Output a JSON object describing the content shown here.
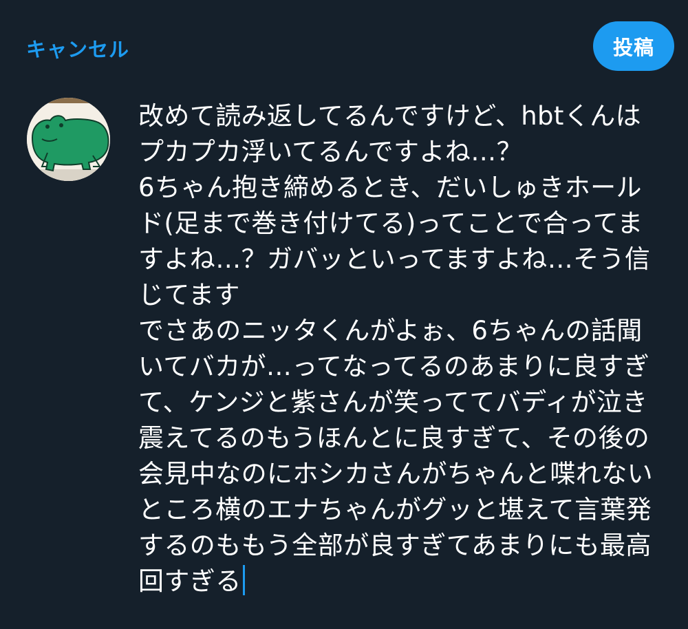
{
  "header": {
    "cancel_label": "キャンセル",
    "post_label": "投稿"
  },
  "avatar": {
    "icon": "frog-icon"
  },
  "composer": {
    "lines": [
      "改めて読み返してるんですけど、hbtくんは",
      "プカプカ浮いてるんですよね…？",
      "6ちゃん抱き締めるとき、だいしゅきホール",
      "ド(足まで巻き付けてる)ってことで合ってま",
      "すよね…？ガバッといってますよね…そう信",
      "じてます",
      "でさあのニッタくんがよぉ、6ちゃんの話聞",
      "いてバカが…ってなってるのあまりに良すぎ",
      "て、ケンジと紫さんが笑っててバディが泣き",
      "震えてるのもうほんとに良すぎて、その後の",
      "会見中なのにホシカさんがちゃんと喋れない",
      "ところ横のエナちゃんがグッと堪えて言葉発",
      "するのももう全部が良すぎてあまりにも最高",
      "回すぎる"
    ]
  },
  "colors": {
    "background": "#15202b",
    "accent": "#1d9bf0",
    "text": "#ffffff"
  }
}
